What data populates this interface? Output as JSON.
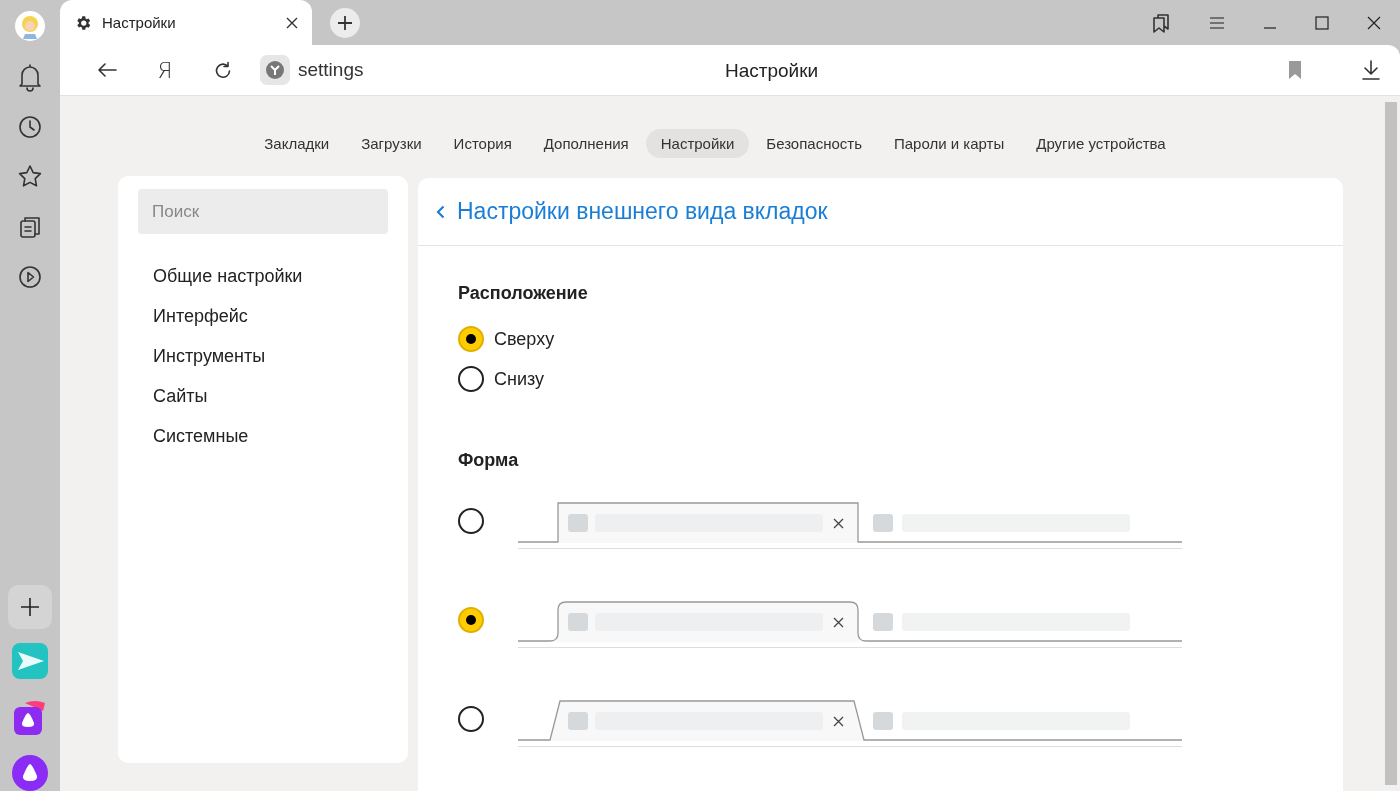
{
  "window": {
    "tab_title": "Настройки",
    "yandex_letter": "Я",
    "address": "settings",
    "page_title": "Настройки"
  },
  "nav_tabs": [
    {
      "label": "Закладки",
      "selected": false
    },
    {
      "label": "Загрузки",
      "selected": false
    },
    {
      "label": "История",
      "selected": false
    },
    {
      "label": "Дополнения",
      "selected": false
    },
    {
      "label": "Настройки",
      "selected": true
    },
    {
      "label": "Безопасность",
      "selected": false
    },
    {
      "label": "Пароли и карты",
      "selected": false
    },
    {
      "label": "Другие устройства",
      "selected": false
    }
  ],
  "search": {
    "placeholder": "Поиск"
  },
  "menu": [
    "Общие настройки",
    "Интерфейс",
    "Инструменты",
    "Сайты",
    "Системные"
  ],
  "panel": {
    "title": "Настройки внешнего вида вкладок",
    "position": {
      "heading": "Расположение",
      "options": [
        {
          "label": "Сверху",
          "selected": true
        },
        {
          "label": "Снизу",
          "selected": false
        }
      ]
    },
    "shape": {
      "heading": "Форма",
      "options": [
        {
          "kind": "square",
          "selected": false
        },
        {
          "kind": "rounded",
          "selected": true
        },
        {
          "kind": "slanted",
          "selected": false
        }
      ]
    }
  }
}
